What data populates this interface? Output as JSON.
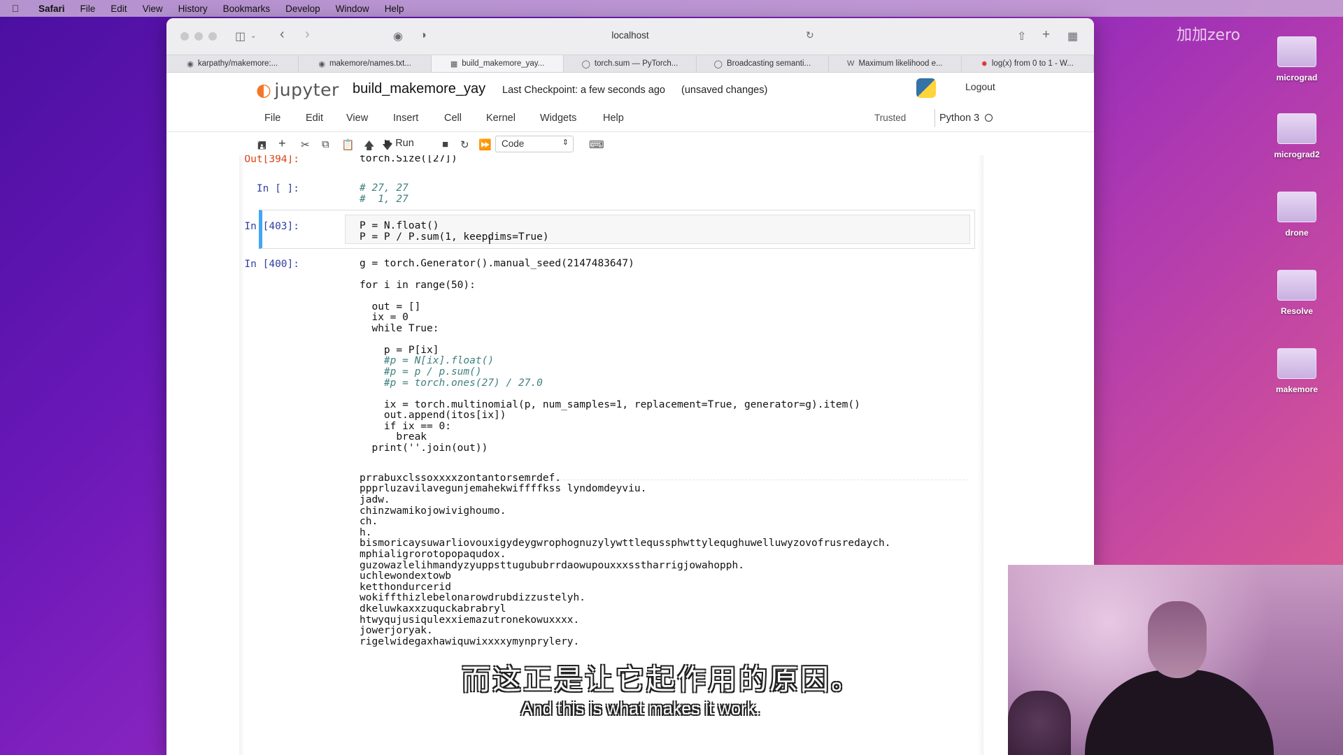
{
  "menubar": {
    "items": [
      "Safari",
      "File",
      "Edit",
      "View",
      "History",
      "Bookmarks",
      "Develop",
      "Window",
      "Help"
    ]
  },
  "desktop": {
    "icons": [
      "micrograd",
      "micrograd2",
      "drone",
      "Resolve",
      "makemore"
    ],
    "watermark": "加加zero"
  },
  "browser": {
    "url": "localhost",
    "tabs": [
      {
        "label": "karpathy/makemore:...",
        "icon": "github-icon"
      },
      {
        "label": "makemore/names.txt...",
        "icon": "github-icon"
      },
      {
        "label": "build_makemore_yay...",
        "icon": "notebook-icon",
        "active": true
      },
      {
        "label": "torch.sum — PyTorch...",
        "icon": "pytorch-icon"
      },
      {
        "label": "Broadcasting semanti...",
        "icon": "pytorch-icon"
      },
      {
        "label": "Maximum likelihood e...",
        "icon": "wikipedia-icon"
      },
      {
        "label": "log(x) from 0 to 1 - W...",
        "icon": "wolfram-icon"
      }
    ]
  },
  "jupyter": {
    "logo_text": "jupyter",
    "notebook_name": "build_makemore_yay",
    "checkpoint": "Last Checkpoint: a few seconds ago",
    "unsaved": "(unsaved changes)",
    "logout": "Logout",
    "menu": [
      "File",
      "Edit",
      "View",
      "Insert",
      "Cell",
      "Kernel",
      "Widgets",
      "Help"
    ],
    "trusted": "Trusted",
    "kernel": "Python 3",
    "toolbar": {
      "run_label": "Run",
      "cell_type": "Code"
    }
  },
  "cells": {
    "out394": {
      "prompt": "Out[394]:",
      "text": "torch.Size([27])"
    },
    "in_blank": {
      "prompt": "In [ ]:",
      "line1": "# 27, 27",
      "line2": "#  1, 27"
    },
    "in403": {
      "prompt": "In [403]:",
      "line1": "P = N.float()",
      "line2": "P = P / P.sum(1, keepdims=True)"
    },
    "in400": {
      "prompt": "In [400]:",
      "lines": [
        "g = torch.Generator().manual_seed(2147483647)",
        "",
        "for i in range(50):",
        "",
        "  out = []",
        "  ix = 0",
        "  while True:",
        "",
        "    p = P[ix]",
        "    #p = N[ix].float()",
        "    #p = p / p.sum()",
        "    #p = torch.ones(27) / 27.0",
        "",
        "    ix = torch.multinomial(p, num_samples=1, replacement=True, generator=g).item()",
        "    out.append(itos[ix])",
        "    if ix == 0:",
        "      break",
        "  print(''.join(out))"
      ],
      "output": [
        "prrabuxclssoxxxxzontantorsemrdef.",
        "ppprluzavilavegunjemahekwiffffkss lyndomdeyviu.",
        "jadw.",
        "chinzwamikojowivighoumo.",
        "ch.",
        "h.",
        "bismoricaysuwarliovouxigydeygwrophognuzylywttlequssphwttylequghuwelluwyzovofrusredaych.",
        "mphialigrorotopopaqudox.",
        "guzowazlelihmandyzyuppsttugububrrdaowupouxxxsstharrigjowahopph.",
        "uchlewondextowb",
        "ketthondurcerid",
        "wokiffthizlebelonarowdrubdizzustelyh.",
        "dkeluwkaxxzuquckabrabryl",
        "htwyqujusiqulexxiemazutronekowuxxxx.",
        "jowerjoryak.",
        "rigelwidegaxhawiquwixxxxymynprylery."
      ]
    }
  },
  "subtitles": {
    "cn": "而这正是让它起作用的原因。",
    "en": "And this is what makes it work."
  }
}
